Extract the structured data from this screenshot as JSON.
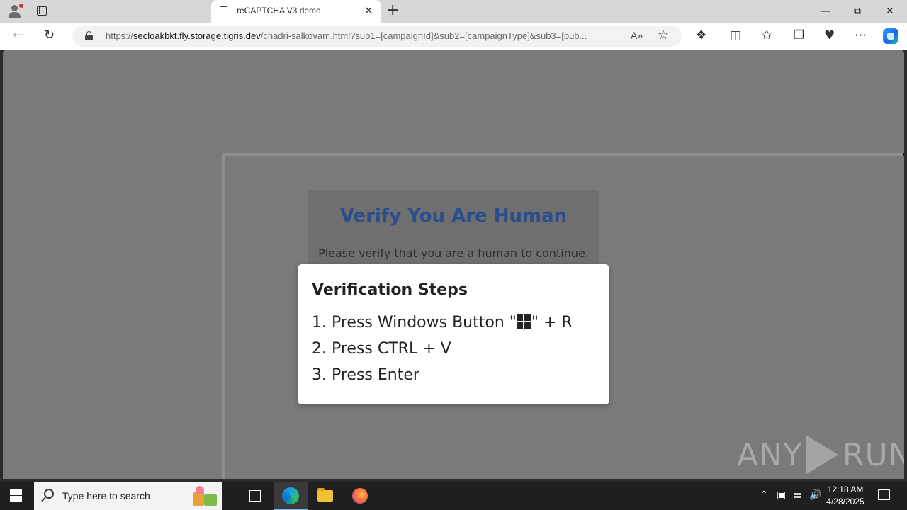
{
  "browser": {
    "tab_title": "reCAPTCHA V3 demo",
    "url_prefix": "https://",
    "url_host": "secloakbkt.fly.storage.tigris.dev",
    "url_path": "/chadri-salkovam.html?sub1=[campaignId]&sub2=[campaignType]&sub3=[pub...",
    "read_aloud": "A»",
    "window_controls": {
      "minimize": "—",
      "maximize": "⧉",
      "close": "✕"
    },
    "new_tab": "+",
    "tab_close": "✕"
  },
  "page": {
    "captcha_title": "Verify You Are Human",
    "captcha_subtitle": "Please verify that you are a human to continue.",
    "steps_title": "Verification Steps",
    "step1_prefix": "1. Press Windows Button \"",
    "step1_suffix": "\" + R",
    "step2": "2. Press CTRL + V",
    "step3": "3. Press Enter",
    "watermark_left": "ANY",
    "watermark_right": "RUN"
  },
  "taskbar": {
    "search_placeholder": "Type here to search",
    "time": "12:18 AM",
    "date": "4/28/2025"
  },
  "colors": {
    "captcha_title": "#2a4d8b",
    "page_overlay": "#7a7a7a",
    "taskbar": "#1f1f1f"
  }
}
